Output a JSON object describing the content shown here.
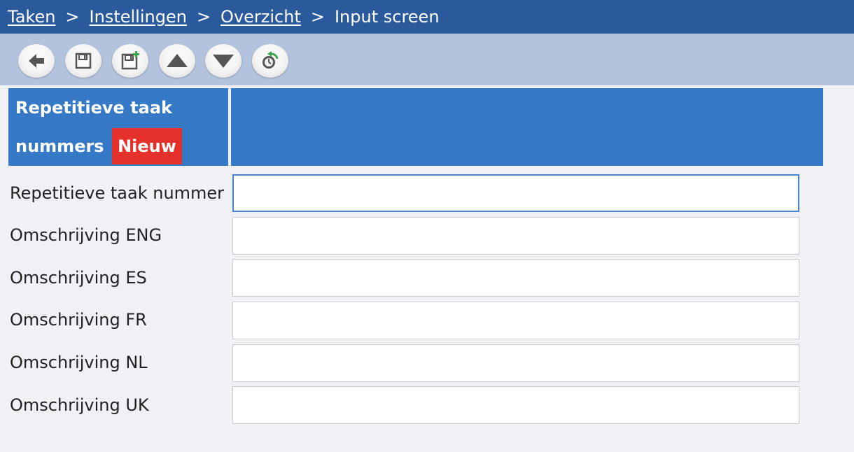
{
  "breadcrumb": {
    "items": [
      {
        "label": "Taken"
      },
      {
        "label": "Instellingen"
      },
      {
        "label": "Overzicht"
      }
    ],
    "separator": ">",
    "current": "Input screen"
  },
  "toolbar": {
    "buttons": [
      {
        "icon": "arrow-left-icon"
      },
      {
        "icon": "save-icon"
      },
      {
        "icon": "save-new-icon"
      },
      {
        "icon": "arrow-up-icon"
      },
      {
        "icon": "arrow-down-icon"
      },
      {
        "icon": "reset-timer-icon"
      }
    ]
  },
  "header": {
    "title_line1": "Repetitieve taak",
    "title_line2": "nummers",
    "badge": "Nieuw"
  },
  "form": {
    "fields": [
      {
        "label": "Repetitieve taak nummer",
        "value": "",
        "focused": true
      },
      {
        "label": "Omschrijving ENG",
        "value": ""
      },
      {
        "label": "Omschrijving ES",
        "value": ""
      },
      {
        "label": "Omschrijving FR",
        "value": ""
      },
      {
        "label": "Omschrijving NL",
        "value": ""
      },
      {
        "label": "Omschrijving UK",
        "value": ""
      }
    ]
  },
  "colors": {
    "breadcrumb_bg": "#2a5a9b",
    "toolbar_bg": "#b4c3dd",
    "header_bg": "#3578c6",
    "badge_bg": "#e5302b",
    "page_bg": "#f0f1f5"
  }
}
